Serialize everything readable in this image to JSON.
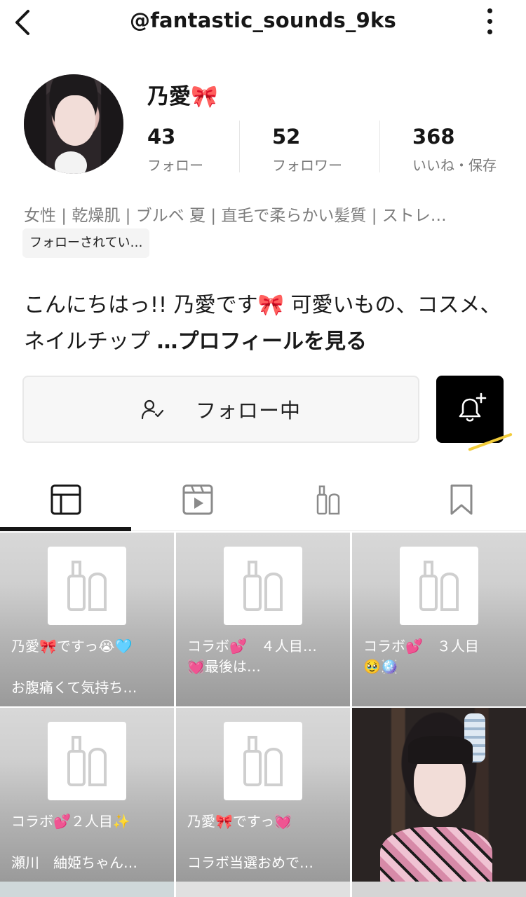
{
  "header": {
    "username": "@fantastic_sounds_9ks"
  },
  "profile": {
    "display_name": "乃愛🎀",
    "stats": [
      {
        "value": "43",
        "label": "フォロー"
      },
      {
        "value": "52",
        "label": "フォロワー"
      },
      {
        "value": "368",
        "label": "いいね・保存"
      }
    ],
    "tags": "女性 | 乾燥肌 | ブルベ 夏 | 直毛で柔らかい髪質 | ストレ…",
    "followed_badge": "フォローされてい…",
    "bio_text": "こんにちはっ!! 乃愛です🎀 可愛いもの、コスメ、ネイルチップ ",
    "bio_more": "…プロフィールを見る"
  },
  "actions": {
    "following_label": "フォロー中"
  },
  "tabs": [
    {
      "icon": "grid-icon",
      "active": true
    },
    {
      "icon": "video-icon",
      "active": false
    },
    {
      "icon": "cosmetics-icon",
      "active": false
    },
    {
      "icon": "bookmark-icon",
      "active": false
    }
  ],
  "posts": [
    {
      "line1": "乃愛🎀ですっ😭🩵",
      "line2": "お腹痛くて気持ち…"
    },
    {
      "line1": "コラボ💕　４人目…\n💓最後は…",
      "line2": ""
    },
    {
      "line1": "コラボ💕　３人目\n🥹🪩",
      "line2": ""
    },
    {
      "line1": "コラボ💕２人目✨",
      "line2": "瀬川　紬姫ちゃん…"
    },
    {
      "line1": "乃愛🎀ですっ💓",
      "line2": "コラボ当選おめで…"
    }
  ],
  "colors": {
    "text": "#161616",
    "muted": "#7a7a7a",
    "bell_bg": "#000000",
    "accent_streak": "#f2cc3a"
  }
}
